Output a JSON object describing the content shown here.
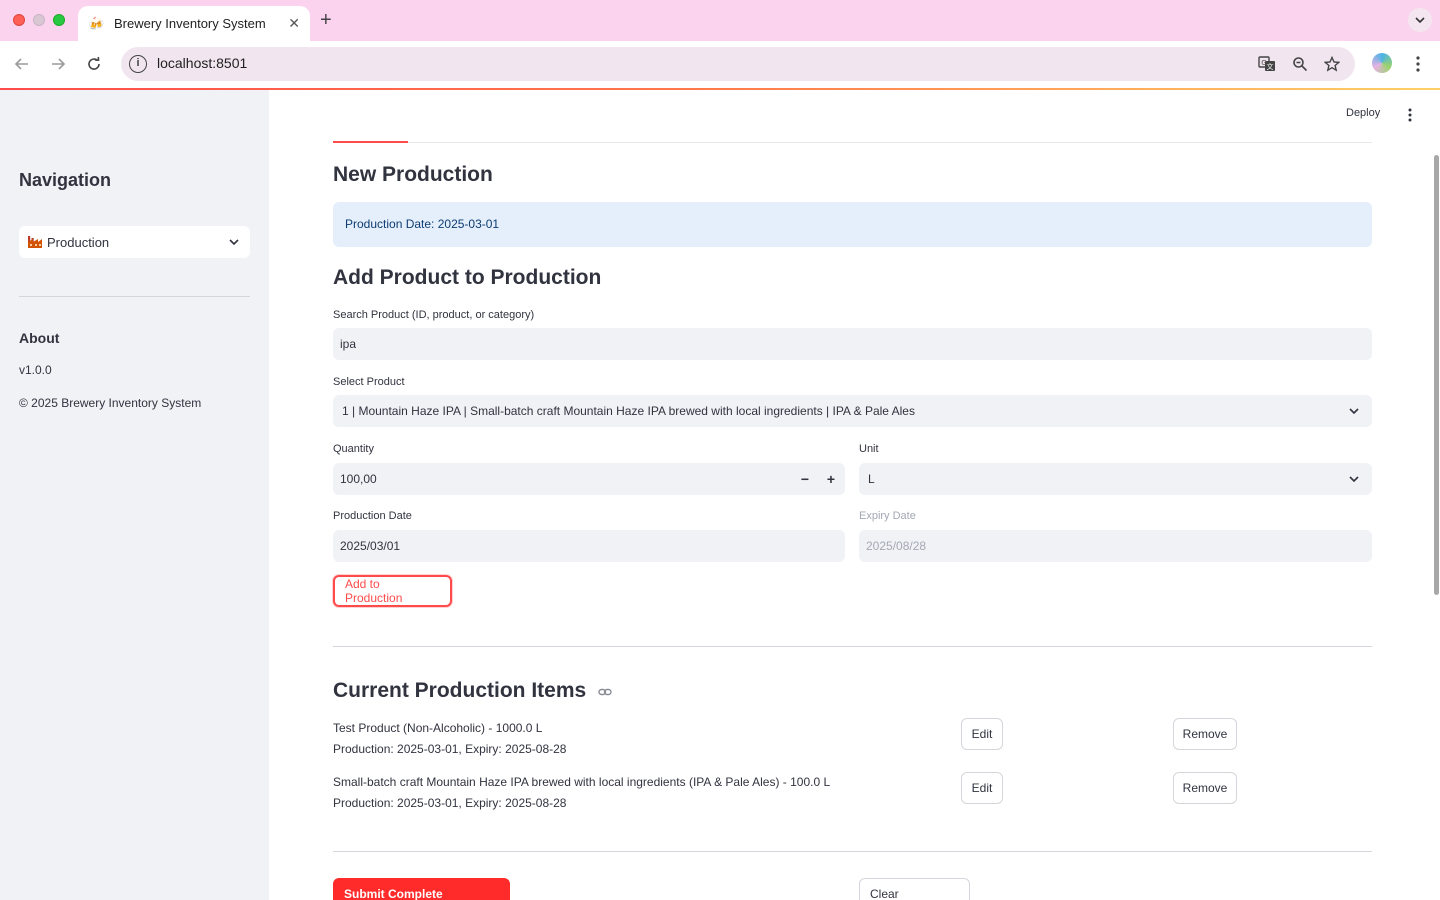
{
  "browser": {
    "tab_title": "Brewery Inventory System",
    "tab_favicon": "beer-mugs-icon",
    "url": "localhost:8501"
  },
  "header": {
    "deploy_label": "Deploy"
  },
  "sidebar": {
    "title": "Navigation",
    "nav_select_value": "Production",
    "nav_select_icon": "factory-icon",
    "about_title": "About",
    "version": "v1.0.0",
    "copyright": "© 2025 Brewery Inventory System"
  },
  "main": {
    "section_title": "New Production",
    "info_text": "Production Date: 2025-03-01",
    "add_title": "Add Product to Production",
    "search": {
      "label": "Search Product (ID, product, or category)",
      "value": "ipa"
    },
    "select_product": {
      "label": "Select Product",
      "value": "1 | Mountain Haze IPA | Small-batch craft Mountain Haze IPA brewed with local ingredients | IPA & Pale Ales"
    },
    "quantity": {
      "label": "Quantity",
      "value": "100,00",
      "minus": "−",
      "plus": "+"
    },
    "unit": {
      "label": "Unit",
      "value": "L"
    },
    "production_date": {
      "label": "Production Date",
      "value": "2025/03/01"
    },
    "expiry_date": {
      "label": "Expiry Date",
      "value": "2025/08/28"
    },
    "add_button": "Add to Production",
    "current_title": "Current Production Items",
    "items": [
      {
        "line1": "Test Product (Non-Alcoholic) - 1000.0 L",
        "line2": "Production: 2025-03-01, Expiry: 2025-08-28",
        "edit": "Edit",
        "remove": "Remove"
      },
      {
        "line1": "Small-batch craft Mountain Haze IPA brewed with local ingredients (IPA & Pale Ales) - 100.0 L",
        "line2": "Production: 2025-03-01, Expiry: 2025-08-28",
        "edit": "Edit",
        "remove": "Remove"
      }
    ],
    "submit_button": "Submit Complete Production",
    "clear_button": "Clear Production"
  },
  "colors": {
    "accent": "#ff4b4b",
    "sidebar_bg": "#f0f2f6",
    "info_bg": "#e4effb",
    "tabbar_bg": "#fbd3ef"
  }
}
